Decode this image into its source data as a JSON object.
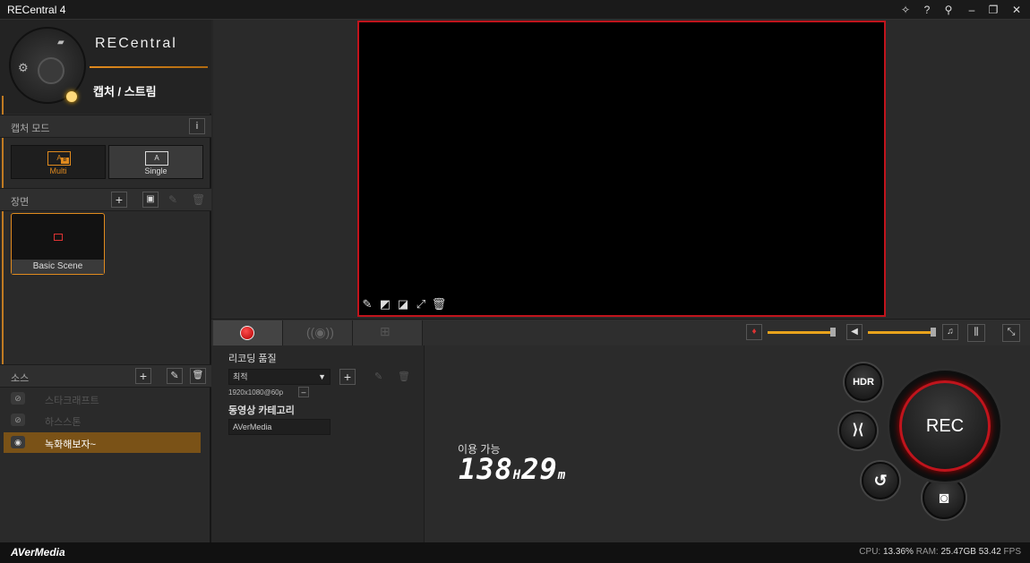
{
  "app": {
    "title": "RECentral 4"
  },
  "titlebar": {
    "icons": [
      "wrench-icon",
      "help-icon",
      "pin-icon",
      "minimize-icon",
      "restore-icon",
      "close-icon"
    ]
  },
  "brand": {
    "logo_text": "RECentral",
    "mode": "캡처 / 스트림"
  },
  "capture_mode": {
    "title": "캡처 모드",
    "info": "i",
    "multi_label": "Multi",
    "single_label": "Single",
    "icon_a": "A",
    "icon_b": "B",
    "selected": "Multi"
  },
  "scenes": {
    "title": "장면",
    "items": [
      {
        "label": "Basic Scene"
      }
    ]
  },
  "sources": {
    "title": "소스",
    "items": [
      {
        "label": "스타크래프트",
        "visible": false
      },
      {
        "label": "하스스톤",
        "visible": false
      },
      {
        "label": "녹화해보자~",
        "visible": true,
        "selected": true
      }
    ]
  },
  "footer": {
    "brand": "AVerMedia"
  },
  "tabs": [
    {
      "name": "record",
      "icon": "record-icon"
    },
    {
      "name": "stream",
      "icon": "broadcast-icon"
    },
    {
      "name": "network",
      "icon": "network-icon"
    }
  ],
  "recording": {
    "quality_label": "리코딩 품질",
    "quality_value": "최적",
    "resolution": "1920x1080@60p",
    "category_label": "동영상 카테고리",
    "category_value": "AVerMedia"
  },
  "available": {
    "label": "이용 가능",
    "hours": "138",
    "hours_unit": "H",
    "minutes": "29",
    "minutes_unit": "m"
  },
  "volume": {
    "mic_level": 0.97,
    "speaker_level": 0.97
  },
  "controls": {
    "hdr": "HDR",
    "rec": "REC"
  },
  "status": {
    "cpu_label": "CPU:",
    "cpu_value": "13.36%",
    "ram_label": "RAM:",
    "ram_value": "25.47GB",
    "fps_value": "53.42",
    "fps_label": "FPS"
  },
  "colors": {
    "accent": "#e08a1e",
    "rec_red": "#c0141c"
  }
}
